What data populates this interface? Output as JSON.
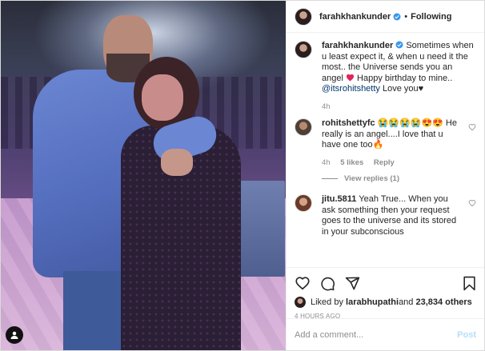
{
  "post": {
    "username": "farahkhankunder",
    "follow_separator": "•",
    "follow_label": "Following",
    "caption_username": "farahkhankunder",
    "caption_text_1": "Sometimes when u least expect it, & when u need it the most.. the Universe sends you an angel ",
    "caption_text_2": " Happy birthday to mine.. ",
    "caption_mention": "@itsrohitshetty",
    "caption_text_3": " Love you",
    "caption_heart": "♥",
    "caption_age": "4h"
  },
  "comments": [
    {
      "username": "rohitshettyfc",
      "text_1": " ",
      "emojis": "😭😭😭😭😍😍",
      "text_2": " He really is an angel....I love that u have one too",
      "fire": "🔥",
      "age": "4h",
      "likes": "5 likes",
      "reply": "Reply",
      "view_replies": "View replies (1)"
    },
    {
      "username": "jitu.5811",
      "text": " Yeah True... When you ask something then your request goes to the universe and its stored in your subconscious"
    }
  ],
  "likes_summary": {
    "prefix": "Liked by ",
    "user": "larabhupathi",
    "middle": " and ",
    "count": "23,834 others"
  },
  "timestamp": "4 HOURS AGO",
  "comment_box": {
    "placeholder": "Add a comment...",
    "post_label": "Post"
  },
  "colors": {
    "verified": "#3897f0",
    "link": "#00376b",
    "post_disabled": "#b2dffc"
  },
  "icons": [
    "heart-icon",
    "comment-icon",
    "share-icon",
    "bookmark-icon",
    "verified-icon",
    "user-tag-icon"
  ]
}
